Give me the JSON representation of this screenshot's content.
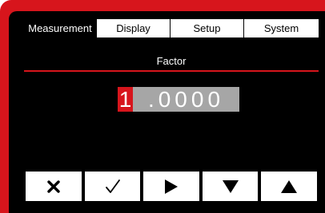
{
  "tabs": {
    "measurement": "Measurement",
    "display": "Display",
    "setup": "Setup",
    "system": "System",
    "active": "Measurement"
  },
  "section": {
    "title": "Factor"
  },
  "factor": {
    "cursor_digit": "1",
    "remaining": ".0000"
  },
  "keys": [
    {
      "icon": "close-icon"
    },
    {
      "icon": "check-icon"
    },
    {
      "icon": "arrow-right-icon"
    },
    {
      "icon": "arrow-down-icon"
    },
    {
      "icon": "arrow-up-icon"
    }
  ],
  "colors": {
    "accent": "#d7151c",
    "screen": "#000000",
    "inactive_field": "#a6a6a6"
  }
}
